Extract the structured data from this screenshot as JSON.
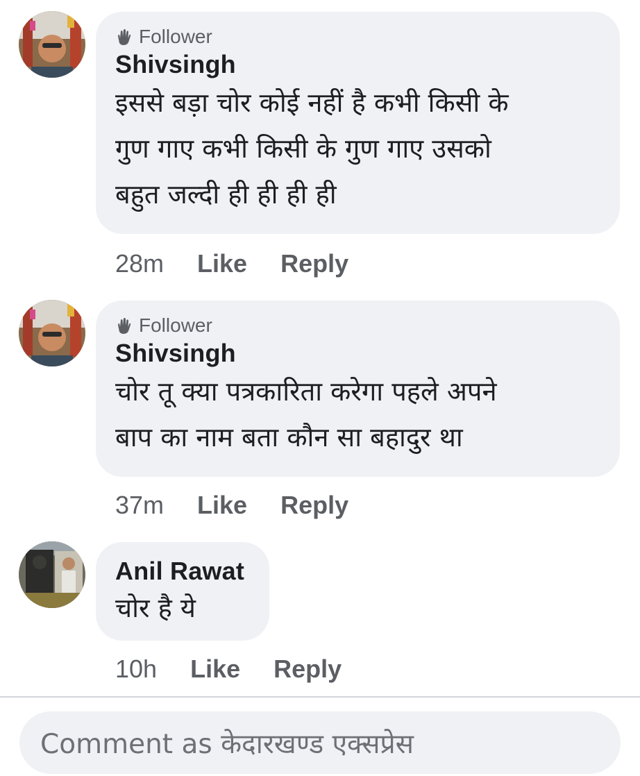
{
  "comments": [
    {
      "badge": "Follower",
      "author": "Shivsingh",
      "text": "इससे बड़ा चोर कोई नहीं है कभी किसी के\nगुण गाए कभी किसी के गुण गाए उसको\nबहुत जल्दी ही ही ही ही",
      "time": "28m",
      "like_label": "Like",
      "reply_label": "Reply"
    },
    {
      "badge": "Follower",
      "author": "Shivsingh",
      "text": "चोर तू क्या पत्रकारिता करेगा पहले अपने\nबाप का नाम बता कौन सा बहादुर था",
      "time": "37m",
      "like_label": "Like",
      "reply_label": "Reply"
    },
    {
      "author": "Anil Rawat",
      "text": "चोर है ये",
      "time": "10h",
      "like_label": "Like",
      "reply_label": "Reply"
    }
  ],
  "composer": {
    "placeholder": "Comment as केदारखण्ड एक्सप्रेस"
  },
  "colors": {
    "bubble": "#eff1f5",
    "meta_text": "#5b5e63",
    "primary_text": "#1c1e21"
  },
  "icons": {
    "follower_badge": "follower-hand-icon"
  }
}
